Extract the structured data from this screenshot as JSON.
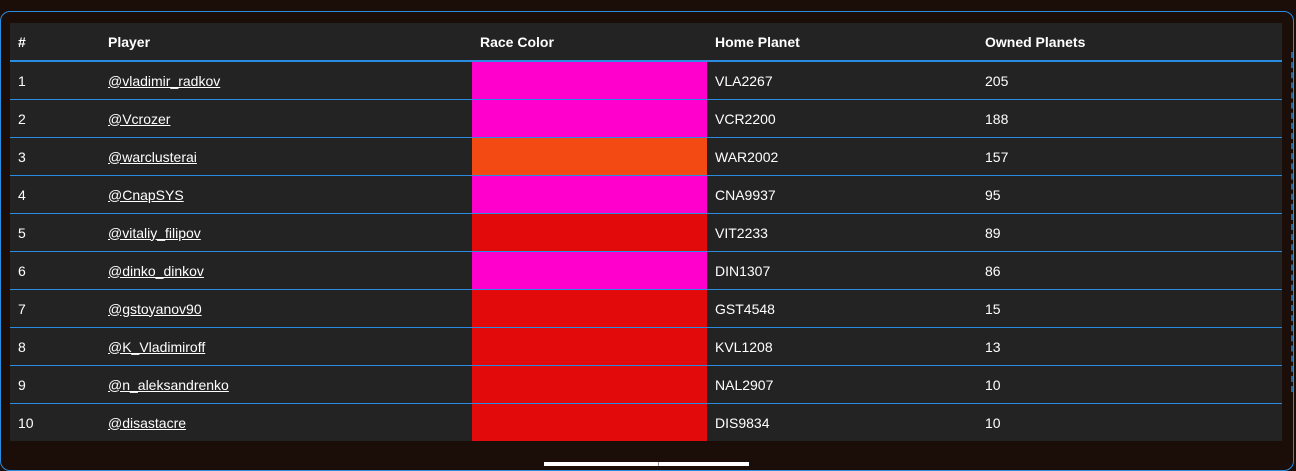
{
  "table": {
    "headers": [
      "#",
      "Player",
      "Race Color",
      "Home Planet",
      "Owned Planets"
    ],
    "rows": [
      {
        "rank": "1",
        "player": "@vladimir_radkov",
        "race_color": "#ff00cc",
        "home_planet": "VLA2267",
        "owned_planets": "205"
      },
      {
        "rank": "2",
        "player": "@Vcrozer",
        "race_color": "#ff00cc",
        "home_planet": "VCR2200",
        "owned_planets": "188"
      },
      {
        "rank": "3",
        "player": "@warclusterai",
        "race_color": "#f24a12",
        "home_planet": "WAR2002",
        "owned_planets": "157"
      },
      {
        "rank": "4",
        "player": "@CnapSYS",
        "race_color": "#ff00cc",
        "home_planet": "CNA9937",
        "owned_planets": "95"
      },
      {
        "rank": "5",
        "player": "@vitaliy_filipov",
        "race_color": "#e20a0a",
        "home_planet": "VIT2233",
        "owned_planets": "89"
      },
      {
        "rank": "6",
        "player": "@dinko_dinkov",
        "race_color": "#ff00cc",
        "home_planet": "DIN1307",
        "owned_planets": "86"
      },
      {
        "rank": "7",
        "player": "@gstoyanov90",
        "race_color": "#e20a0a",
        "home_planet": "GST4548",
        "owned_planets": "15"
      },
      {
        "rank": "8",
        "player": "@K_Vladimiroff",
        "race_color": "#e20a0a",
        "home_planet": "KVL1208",
        "owned_planets": "13"
      },
      {
        "rank": "9",
        "player": "@n_aleksandrenko",
        "race_color": "#e20a0a",
        "home_planet": "NAL2907",
        "owned_planets": "10"
      },
      {
        "rank": "10",
        "player": "@disastacre",
        "race_color": "#e20a0a",
        "home_planet": "DIS9834",
        "owned_planets": "10"
      }
    ]
  },
  "theme": {
    "accent": "#2a8ce0",
    "panel_bg": "#232323",
    "page_bg": "#1b0d08"
  }
}
